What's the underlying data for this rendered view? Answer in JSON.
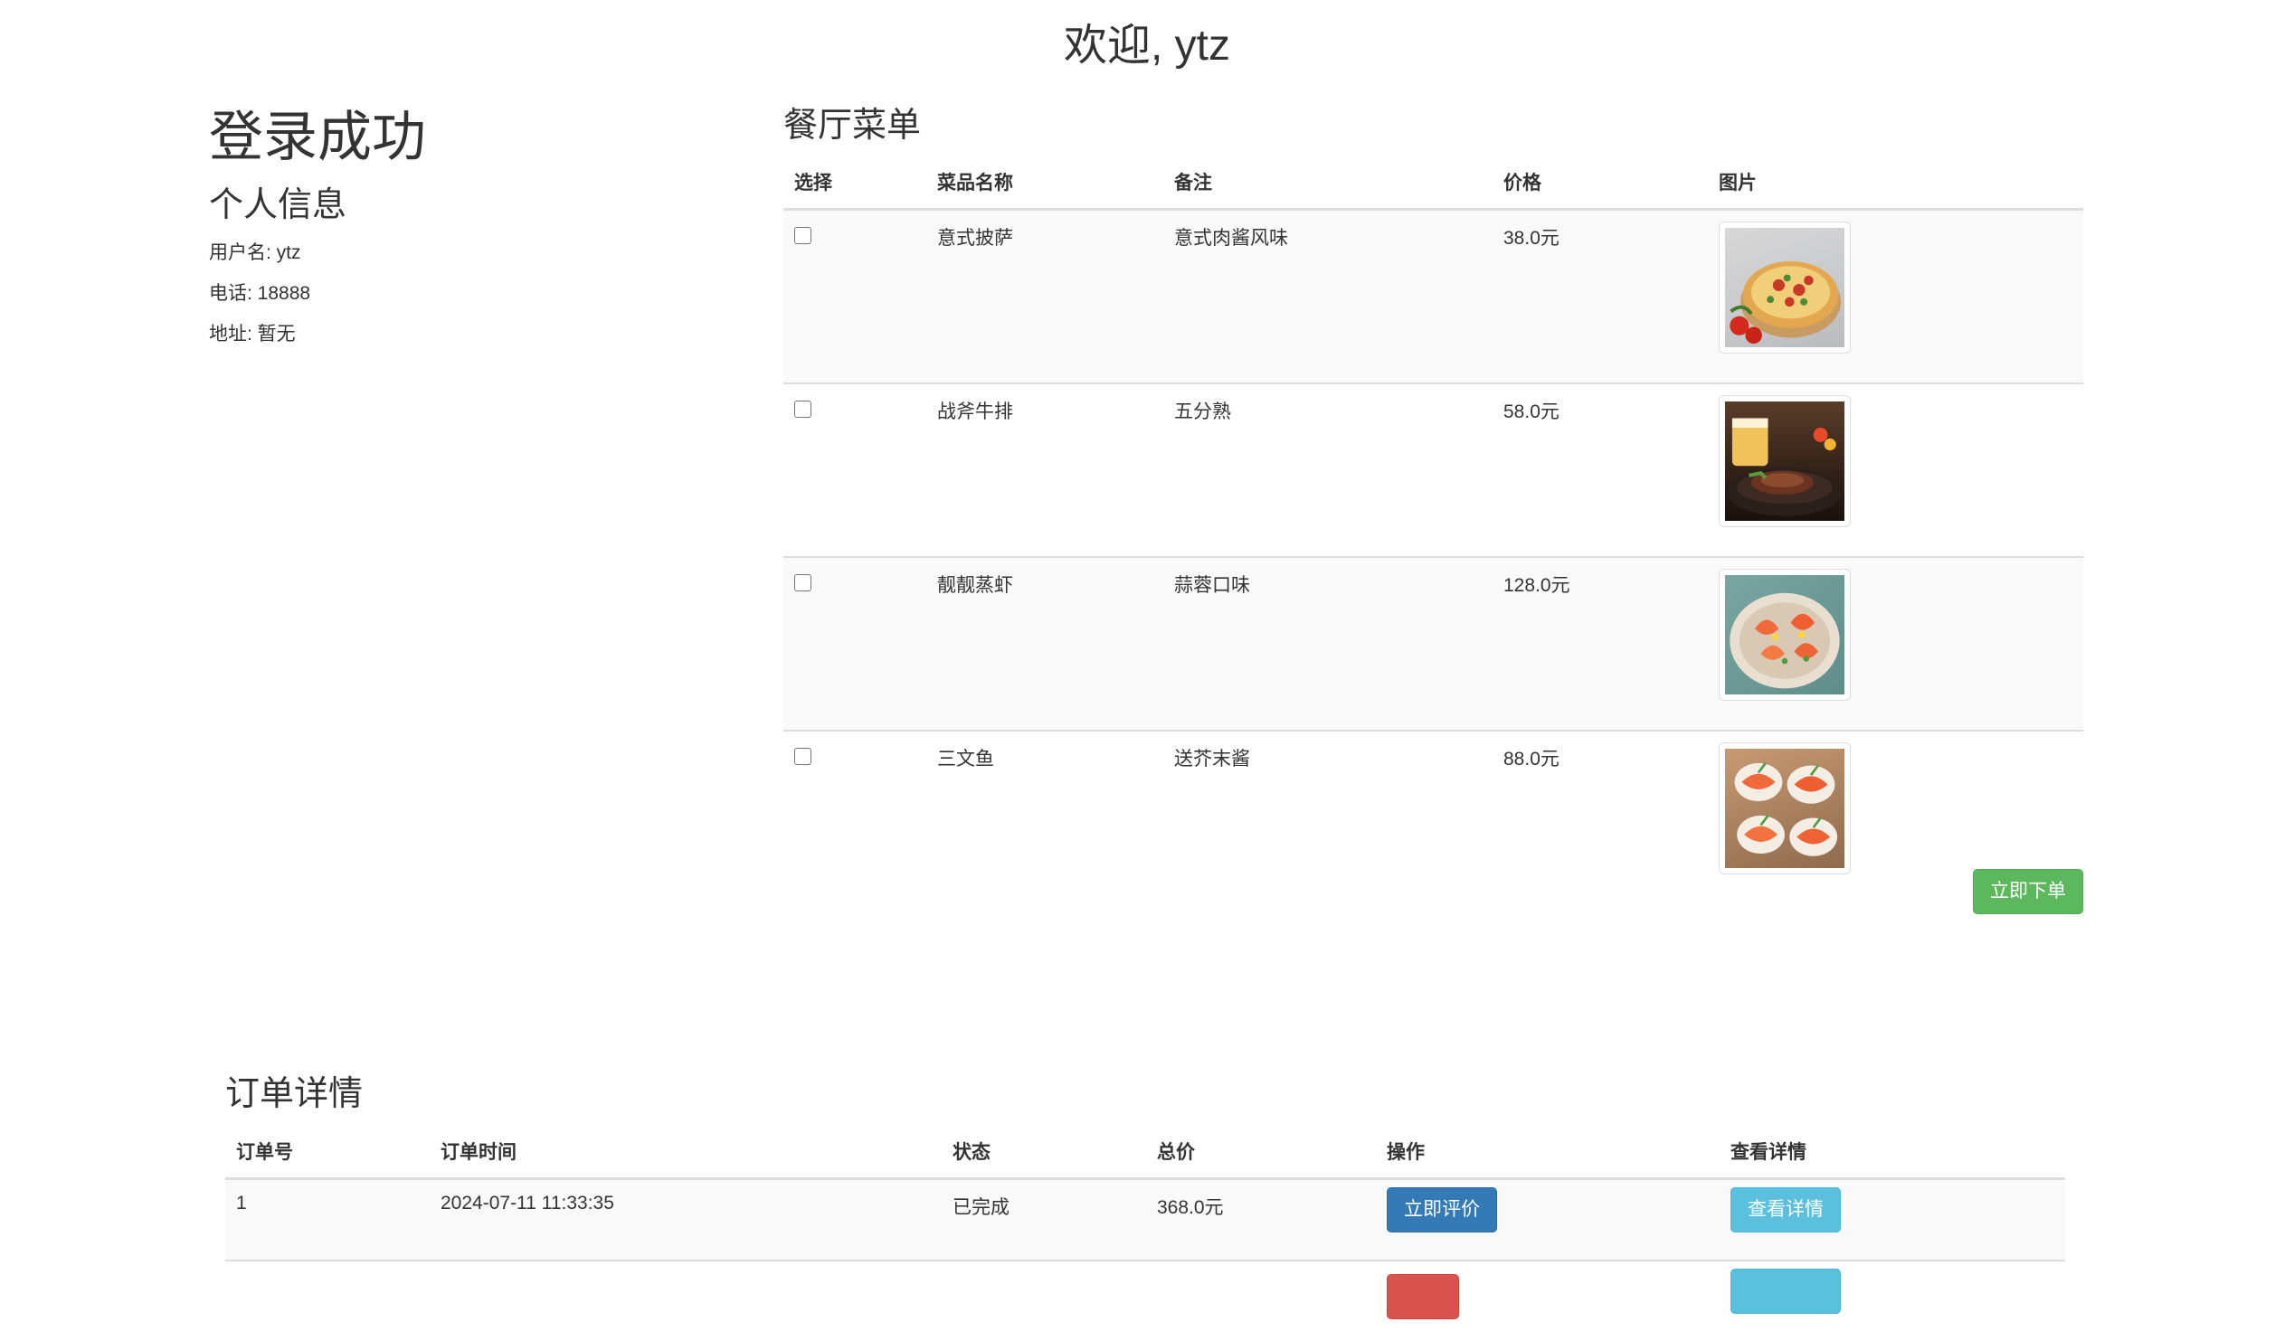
{
  "header": {
    "welcome": "欢迎, ytz"
  },
  "profile": {
    "login_status": "登录成功",
    "section_title": "个人信息",
    "username": "用户名: ytz",
    "phone": "电话: 18888",
    "address": "地址: 暂无"
  },
  "menu": {
    "title": "餐厅菜单",
    "columns": [
      "选择",
      "菜品名称",
      "备注",
      "价格",
      "图片"
    ],
    "rows": [
      {
        "name": "意式披萨",
        "note": "意式肉酱风味",
        "price": "38.0元",
        "image": "pizza-photo",
        "checked": false
      },
      {
        "name": "战斧牛排",
        "note": "五分熟",
        "price": "58.0元",
        "image": "steak-photo",
        "checked": false
      },
      {
        "name": "靓靓蒸虾",
        "note": "蒜蓉口味",
        "price": "128.0元",
        "image": "shrimp-photo",
        "checked": false
      },
      {
        "name": "三文鱼",
        "note": "送芥末酱",
        "price": "88.0元",
        "image": "salmon-photo",
        "checked": false
      }
    ],
    "order_button": "立即下单"
  },
  "orders": {
    "title": "订单详情",
    "columns": [
      "订单号",
      "订单时间",
      "状态",
      "总价",
      "操作",
      "查看详情"
    ],
    "rows": [
      {
        "id": "1",
        "time": "2024-07-11 11:33:35",
        "status": "已完成",
        "total": "368.0元",
        "action": "立即评价",
        "detail": "查看详情"
      }
    ]
  },
  "colors": {
    "success": "#5cb85c",
    "primary": "#337ab7",
    "info": "#5bc0de",
    "danger": "#d9534f"
  }
}
